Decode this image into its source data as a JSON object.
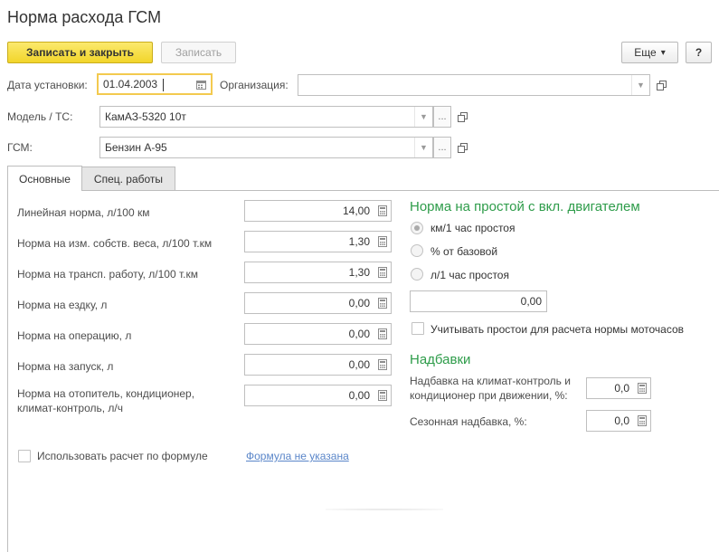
{
  "window": {
    "title": "Норма расхода ГСМ"
  },
  "toolbar": {
    "save_close": "Записать и закрыть",
    "save": "Записать",
    "more": "Еще",
    "more_arrow": "▾",
    "help": "?"
  },
  "header": {
    "date_label": "Дата установки:",
    "date_value": "01.04.2003",
    "org_label": "Организация:",
    "org_value": "",
    "model_label": "Модель / ТС:",
    "model_value": "КамАЗ-5320 10т",
    "fuel_label": "ГСМ:",
    "fuel_value": "Бензин А-95",
    "dots": "..."
  },
  "tabs": [
    {
      "label": "Основные",
      "active": true
    },
    {
      "label": "Спец. работы",
      "active": false
    }
  ],
  "norms": [
    {
      "label": "Линейная норма, л/100 км",
      "value": "14,00"
    },
    {
      "label": "Норма на изм. собств. веса, л/100 т.км",
      "value": "1,30"
    },
    {
      "label": "Норма на трансп. работу, л/100 т.км",
      "value": "1,30"
    },
    {
      "label": "Норма на ездку, л",
      "value": "0,00"
    },
    {
      "label": "Норма на операцию, л",
      "value": "0,00"
    },
    {
      "label": "Норма на запуск, л",
      "value": "0,00"
    },
    {
      "label_line1": "Норма на отопитель, кондиционер,",
      "label_line2": "климат-контроль, л/ч",
      "value": "0,00"
    }
  ],
  "idle": {
    "title": "Норма на простой с вкл. двигателем",
    "options": [
      {
        "label": "км/1 час простоя",
        "checked": true
      },
      {
        "label": "% от базовой",
        "checked": false
      },
      {
        "label": "л/1 час простоя",
        "checked": false
      }
    ],
    "value": "0,00",
    "motohours_label": "Учитывать простои для расчета нормы моточасов"
  },
  "surcharges": {
    "title": "Надбавки",
    "climate_label_line1": "Надбавка на климат-контроль и",
    "climate_label_line2": "кондиционер при движении, %:",
    "climate_value": "0,0",
    "seasonal_label": "Сезонная надбавка, %:",
    "seasonal_value": "0,0"
  },
  "formula": {
    "checkbox_label": "Использовать расчет по формуле",
    "link": "Формула не указана"
  },
  "colors": {
    "primary_button": "#f2d52a",
    "section_title": "#2e9c4a",
    "link": "#5a86c9",
    "focus_border": "#f3ca4f"
  },
  "icons": {
    "calendar": "calendar-icon",
    "calculator": "calculator-icon",
    "open": "open-icon",
    "dropdown": "dropdown-arrow-icon"
  }
}
